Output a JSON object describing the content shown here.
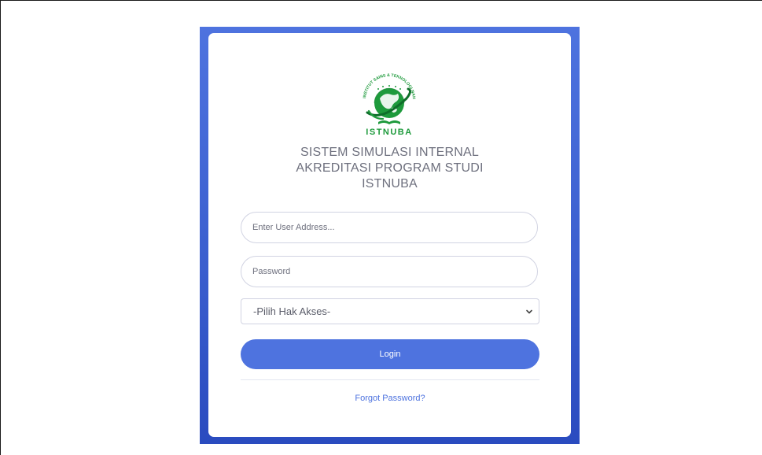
{
  "logo": {
    "name": "ISTNUBA",
    "ring_text": "INSTITUT SAINS & TEKNOLOGI NAHDLATUL ULAMA BALI",
    "colors": {
      "green": "#1e9a3c",
      "dark_green": "#0f6e2a"
    }
  },
  "title_lines": [
    "SISTEM SIMULASI INTERNAL",
    "AKREDITASI PROGRAM STUDI",
    "ISTNUBA"
  ],
  "form": {
    "user_placeholder": "Enter User Address...",
    "password_placeholder": "Password",
    "access_select": {
      "selected": "-Pilih Hak Akses-",
      "icon": "chevron-down-icon"
    },
    "login_label": "Login",
    "forgot_label": "Forgot Password?"
  },
  "colors": {
    "primary": "#4e73df",
    "panel_bottom": "#2a4bbf",
    "text_gray": "#6e707e",
    "border": "#d1d3e2"
  }
}
